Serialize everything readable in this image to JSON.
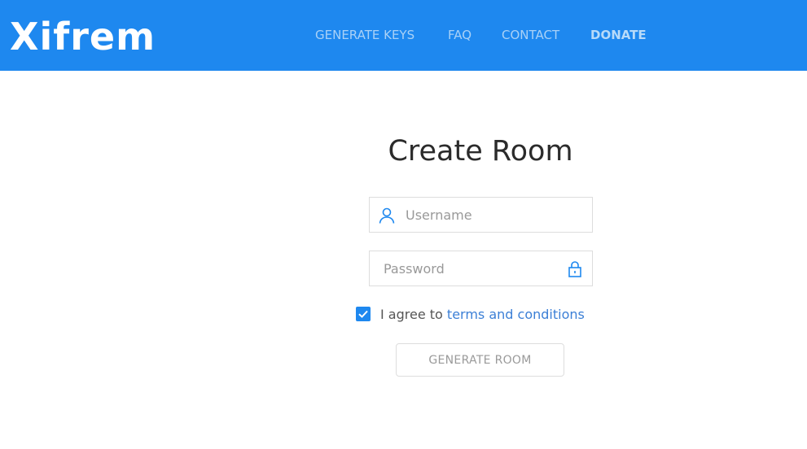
{
  "header": {
    "logo": "Xifrem",
    "nav": {
      "generate_keys": "GENERATE KEYS",
      "faq": "FAQ",
      "contact": "CONTACT",
      "donate": "DONATE"
    }
  },
  "form": {
    "title": "Create Room",
    "username": {
      "placeholder": "Username",
      "value": "",
      "icon": "user-icon"
    },
    "password": {
      "placeholder": "Password",
      "value": "",
      "icon": "lock-icon"
    },
    "agree": {
      "checked": true,
      "prefix": "I agree to ",
      "link": "terms and conditions"
    },
    "submit_label": "GENERATE ROOM"
  },
  "colors": {
    "brand": "#1e88ef",
    "link": "#3b7fd6",
    "checkbox": "#1e88ef"
  }
}
